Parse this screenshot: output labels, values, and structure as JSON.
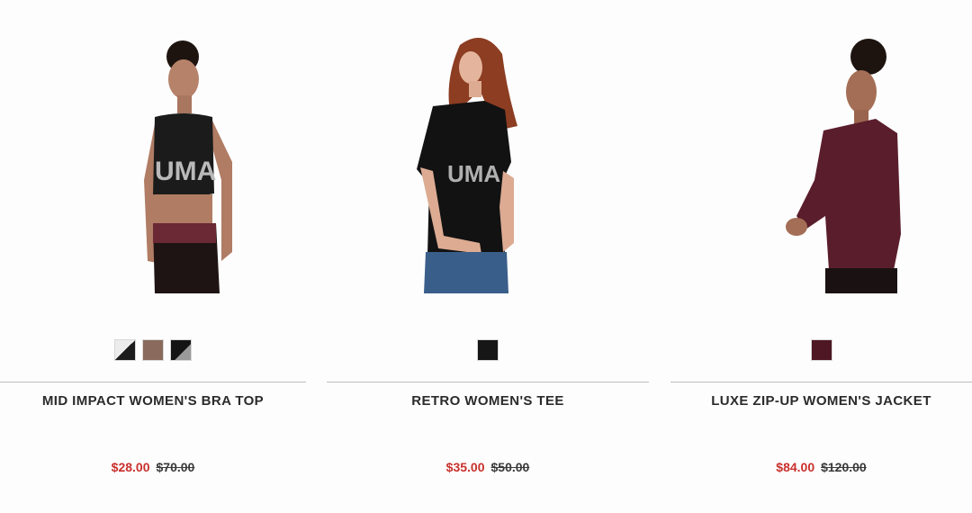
{
  "products": [
    {
      "name": "MID IMPACT WOMEN'S BRA TOP",
      "sale_price": "$28.00",
      "original_price": "$70.00",
      "swatches": [
        {
          "name": "white-black",
          "colors": [
            "#ececec",
            "#1c1c1c"
          ]
        },
        {
          "name": "taupe",
          "colors": [
            "#8a6a5c",
            "#8a6a5c"
          ]
        },
        {
          "name": "black-silver",
          "colors": [
            "#141414",
            "#9a9a9a"
          ]
        }
      ]
    },
    {
      "name": "RETRO WOMEN'S TEE",
      "sale_price": "$35.00",
      "original_price": "$50.00",
      "swatches": [
        {
          "name": "black",
          "colors": [
            "#161616",
            "#161616"
          ]
        }
      ]
    },
    {
      "name": "LUXE ZIP-UP WOMEN'S JACKET",
      "sale_price": "$84.00",
      "original_price": "$120.00",
      "swatches": [
        {
          "name": "burgundy",
          "colors": [
            "#4e1723",
            "#4e1723"
          ]
        }
      ]
    }
  ],
  "colors": {
    "sale_price": "#c9302c",
    "product_name": "#2b2b2b",
    "divider": "#bdbdbd"
  }
}
